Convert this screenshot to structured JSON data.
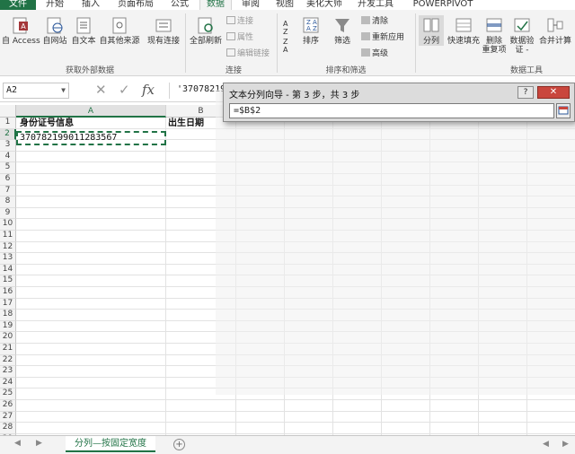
{
  "ribbon_tabs": [
    {
      "label": "文件",
      "state": "file"
    },
    {
      "label": "开始",
      "state": "normal"
    },
    {
      "label": "插入",
      "state": "normal"
    },
    {
      "label": "页面布局",
      "state": "normal"
    },
    {
      "label": "公式",
      "state": "normal"
    },
    {
      "label": "数据",
      "state": "active"
    },
    {
      "label": "审阅",
      "state": "normal"
    },
    {
      "label": "视图",
      "state": "normal"
    },
    {
      "label": "美化大师",
      "state": "normal"
    },
    {
      "label": "开发工具",
      "state": "normal"
    },
    {
      "label": "POWERPIVOT",
      "state": "normal"
    }
  ],
  "ribbon": {
    "external": {
      "from_access": "自 Access",
      "from_web": "自网站",
      "from_text": "自文本",
      "from_other": "自其他来源",
      "existing": "现有连接",
      "group": "获取外部数据"
    },
    "connections": {
      "refresh_all": "全部刷新",
      "connections": "连接",
      "properties": "属性",
      "edit_links": "编辑链接",
      "group": "连接"
    },
    "sort_filter": {
      "sort": "排序",
      "filter": "筛选",
      "clear": "清除",
      "reapply": "重新应用",
      "advanced": "高级",
      "group": "排序和筛选"
    },
    "tools": {
      "text_to_columns": "分列",
      "flash_fill": "快速填充",
      "remove_dup_line1": "删除",
      "remove_dup_line2": "重复项",
      "validation_line1": "数据验",
      "validation_line2": "证 -",
      "consolidate": "合并计算",
      "group": "数据工具"
    }
  },
  "formula_bar": {
    "name_box": "A2",
    "formula": "'37078219"
  },
  "sheet": {
    "columns": [
      "A",
      "B"
    ],
    "rows": [
      "1",
      "2",
      "3",
      "4",
      "5",
      "6",
      "7",
      "8",
      "9",
      "10",
      "11",
      "12",
      "13",
      "14",
      "15",
      "16",
      "17",
      "18",
      "19",
      "20",
      "21",
      "22",
      "23",
      "24",
      "25",
      "26",
      "27",
      "28",
      "29"
    ],
    "cells": {
      "A1": "身份证号信息",
      "B1": "出生日期",
      "A2": "370782199011283567"
    }
  },
  "dialog": {
    "title": "文本分列向导 - 第 3 步，共 3 步",
    "help": "?",
    "close": "✕",
    "input_value": "=$B$2"
  },
  "sheet_tabs": {
    "active": "分列—按固定宽度",
    "add": "+"
  }
}
